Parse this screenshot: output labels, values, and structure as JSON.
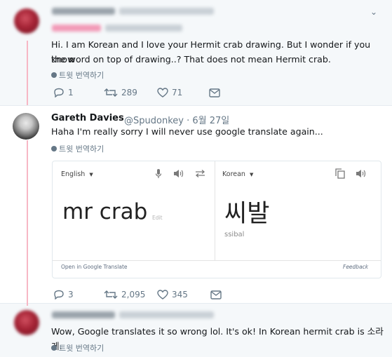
{
  "tweets": [
    {
      "body_line1": "Hi. I am Korean and I love your Hermit crab drawing. But I wonder if you know",
      "body_line2": "the word on top of drawing..? That does not mean Hermit crab.",
      "translate_label": "트윗 번역하기",
      "replies": "1",
      "retweets": "289",
      "likes": "71"
    },
    {
      "name": "Gareth Davies",
      "handle": "@Spudonkey · 6월 27일",
      "body": "Haha I'm really sorry I will never use google translate again...",
      "translate_label": "트윗 번역하기",
      "card": {
        "source_lang": "English",
        "target_lang": "Korean",
        "source_text": "mr crab",
        "edit_label": "Edit",
        "translated_text": "씨발",
        "romanization": "ssibal",
        "open_link": "Open in Google Translate",
        "feedback_link": "Feedback"
      },
      "replies": "3",
      "retweets": "2,095",
      "likes": "345"
    },
    {
      "body": "Wow, Google translates it so wrong lol. It's ok! In Korean hermit crab is 소라게.",
      "translate_label": "트윗 번역하기"
    }
  ],
  "colors": {
    "accent_thread": "#f7b7c5",
    "muted": "#657786",
    "background_highlight": "#f5f8fa"
  }
}
